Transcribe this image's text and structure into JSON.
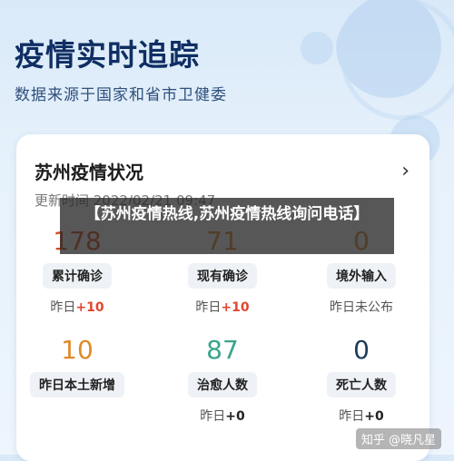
{
  "hero": {
    "title": "疫情实时追踪",
    "subtitle": "数据来源于国家和省市卫健委"
  },
  "card": {
    "title": "苏州疫情状况",
    "update_time": "更新时间 2022/02/21 09:47"
  },
  "overlay": {
    "headline": "【苏州疫情热线,苏州疫情热线询问电话】"
  },
  "stats": [
    {
      "value": "178",
      "label": "累计确诊",
      "delta_prefix": "昨日",
      "delta_value": "+10",
      "color": "#d9481c"
    },
    {
      "value": "71",
      "label": "现有确诊",
      "delta_prefix": "昨日",
      "delta_value": "+10",
      "color": "#e08a2a"
    },
    {
      "value": "0",
      "label": "境外输入",
      "delta_prefix": "昨日未公布",
      "delta_value": "",
      "color": "#e08a2a"
    },
    {
      "value": "10",
      "label": "昨日本土新增",
      "delta_prefix": "",
      "delta_value": "",
      "color": "#e08a2a"
    },
    {
      "value": "87",
      "label": "治愈人数",
      "delta_prefix": "昨日",
      "delta_value": "+0",
      "color": "#3aa58c"
    },
    {
      "value": "0",
      "label": "死亡人数",
      "delta_prefix": "昨日",
      "delta_value": "+0",
      "color": "#1e3b5a"
    }
  ],
  "watermark": "知乎 @晓凡星",
  "icons": {
    "chevron": "chevron-right-icon"
  }
}
